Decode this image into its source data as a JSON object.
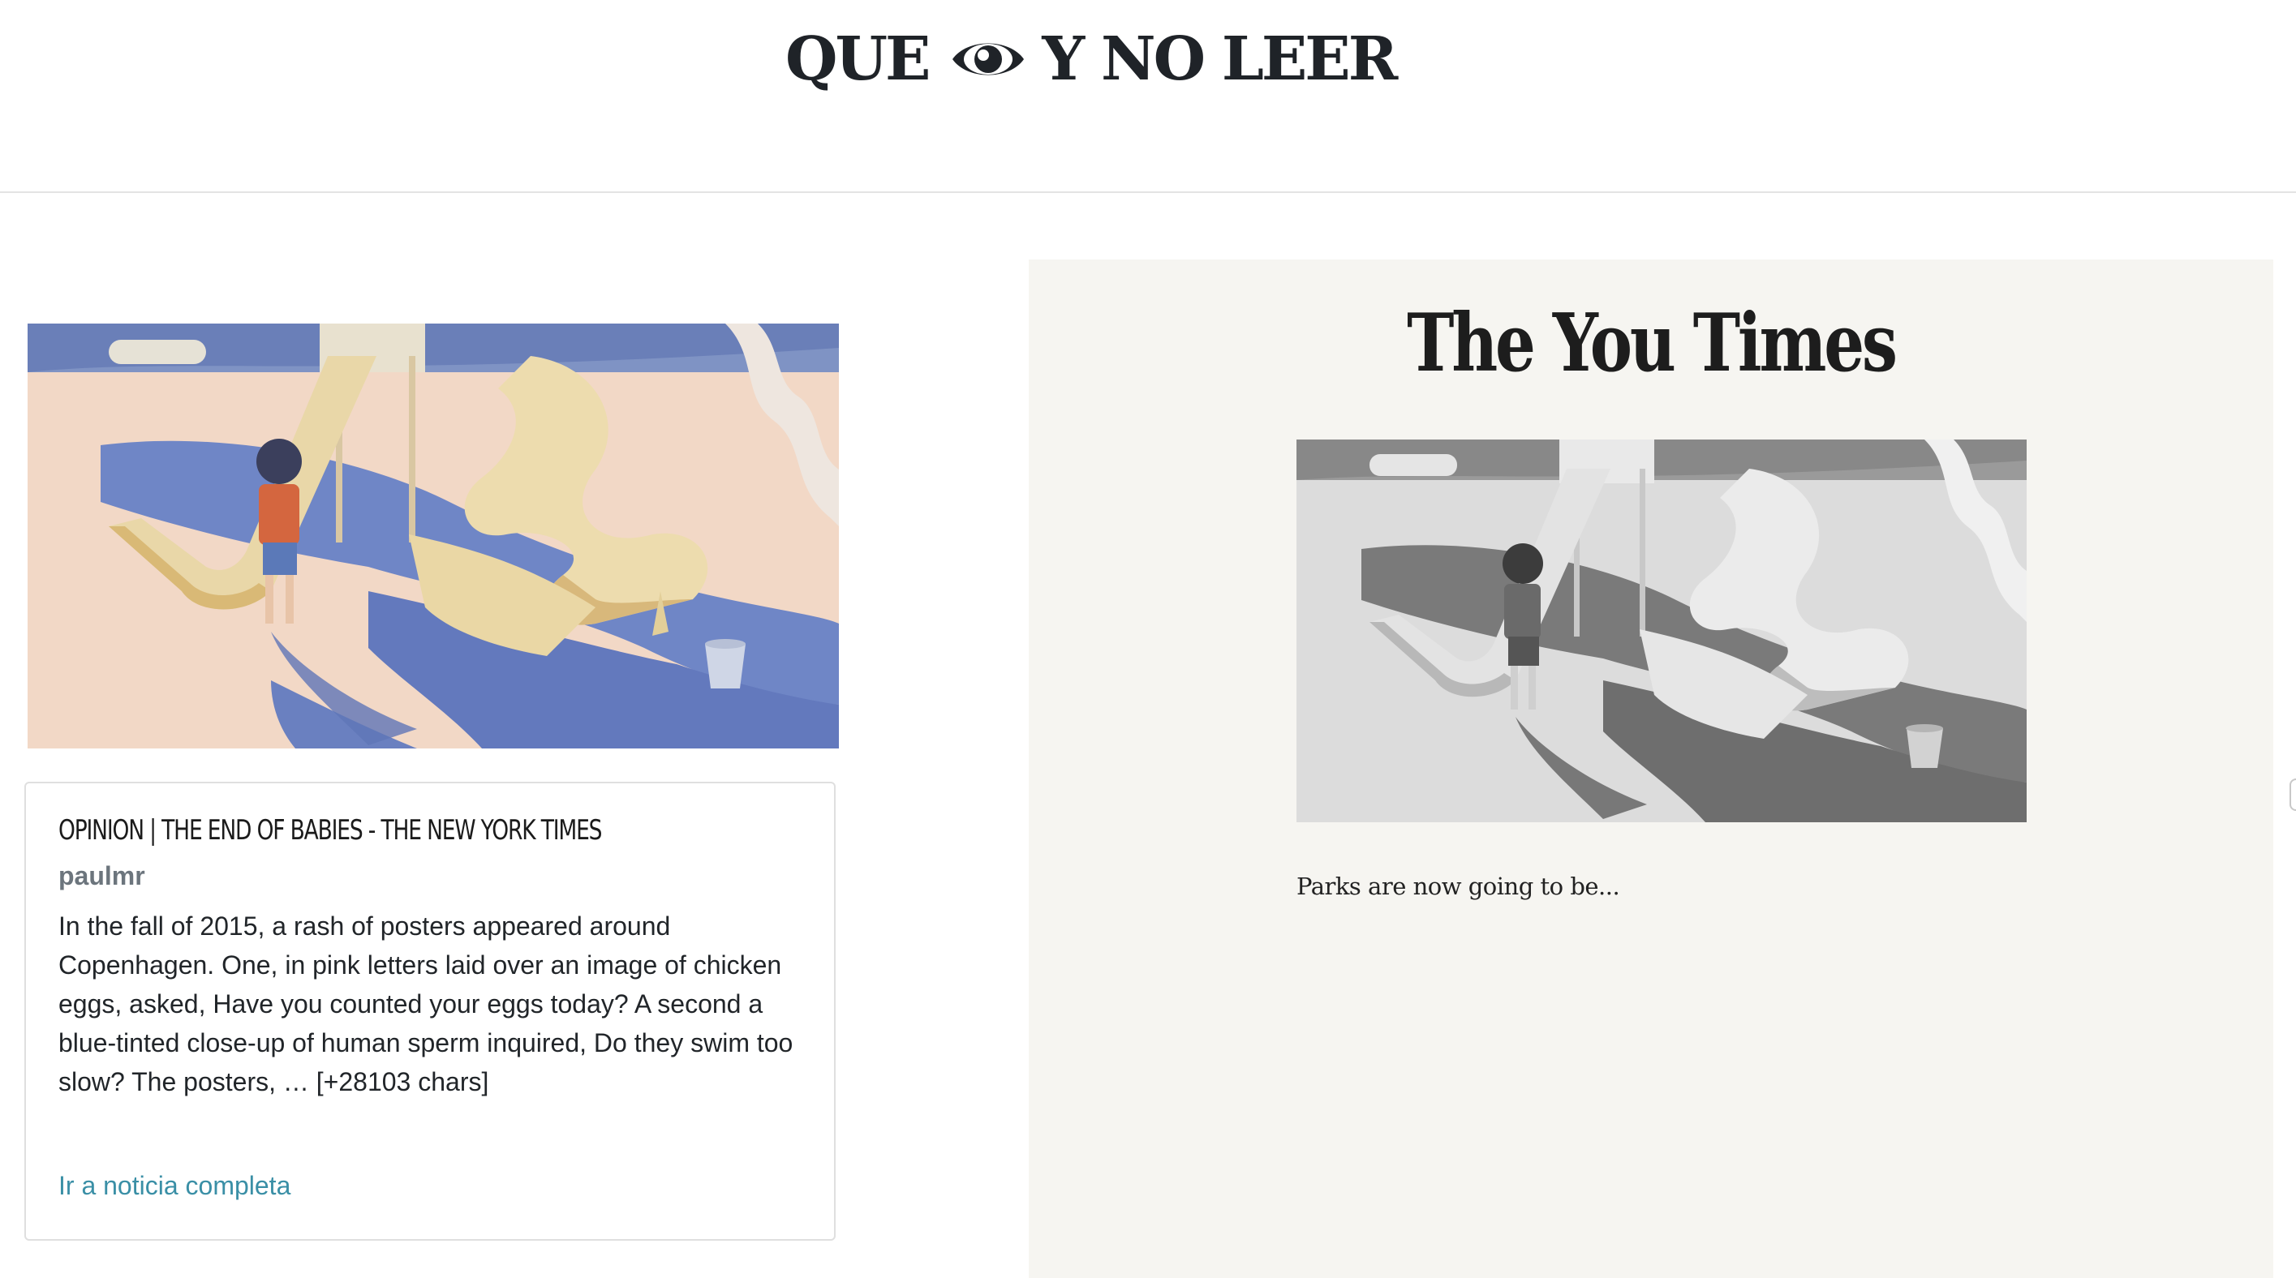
{
  "header": {
    "logo_left": "QUE",
    "logo_icon": "eye-icon",
    "logo_right": "Y NO LEER"
  },
  "article": {
    "image_icon": "playground-illustration",
    "title": "OPINION | THE END OF BABIES - THE NEW YORK TIMES",
    "author": "paulmr",
    "body": "In the fall of 2015, a rash of posters appeared around Copenhagen. One, in pink letters laid over an image of chicken eggs, asked, Have you counted your eggs today? A second a blue-tinted close-up of human sperm inquired, Do they swim too slow? The posters, … [+28103 chars]",
    "link_label": "Ir a noticia completa"
  },
  "you_times": {
    "masthead": "The You Times",
    "image_icon": "playground-illustration-grayscale",
    "summary": "Parks are now going to be..."
  },
  "colors": {
    "link": "#3a8fa6",
    "panel_bg": "#f6f5f1",
    "author": "#6c757d"
  }
}
